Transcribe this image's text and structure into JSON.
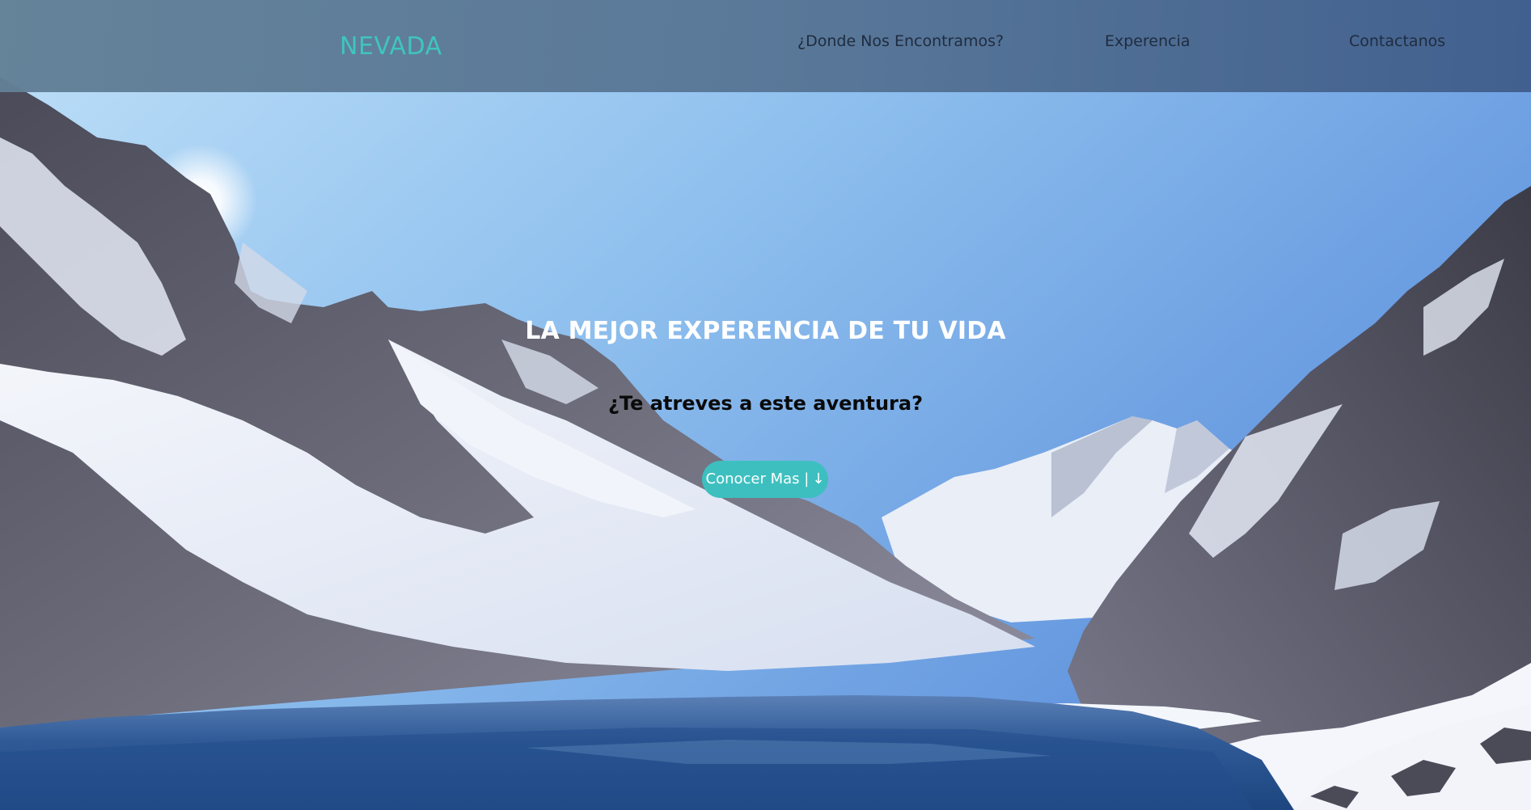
{
  "header": {
    "brand": "NEVADA",
    "nav": [
      {
        "label": "¿Donde Nos Encontramos?"
      },
      {
        "label": "Experencia"
      },
      {
        "label": "Contactanos"
      }
    ]
  },
  "hero": {
    "title": "LA MEJOR EXPERENCIA DE TU VIDA",
    "subtitle": "¿Te atreves a este aventura?",
    "cta": {
      "label": "Conocer Mas |",
      "icon": "arrow-down-icon",
      "glyph": "↓"
    }
  },
  "colors": {
    "brand": "#3fc4c1",
    "nav_text": "#1f2c3f",
    "cta_bg": "#3dbfbf",
    "title": "#ffffff",
    "subtitle": "#0a0a0a"
  }
}
